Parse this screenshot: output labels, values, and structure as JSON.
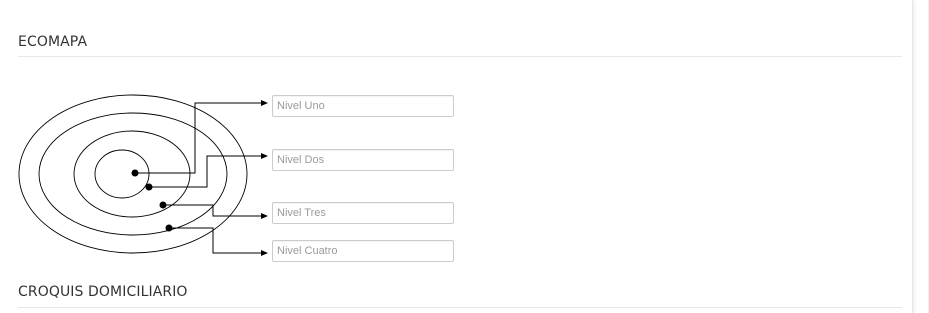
{
  "sections": {
    "ecomapa_title": "ECOMAPA",
    "croquis_title": "CROQUIS DOMICILIARIO"
  },
  "levels": [
    {
      "placeholder": "Nivel Uno"
    },
    {
      "placeholder": "Nivel Dos"
    },
    {
      "placeholder": "Nivel Tres"
    },
    {
      "placeholder": "Nivel Cuatro"
    }
  ],
  "colors": {
    "text": "#333333",
    "rule": "#e8e8e8",
    "input_border": "#cccccc",
    "diagram_line": "#000000"
  }
}
